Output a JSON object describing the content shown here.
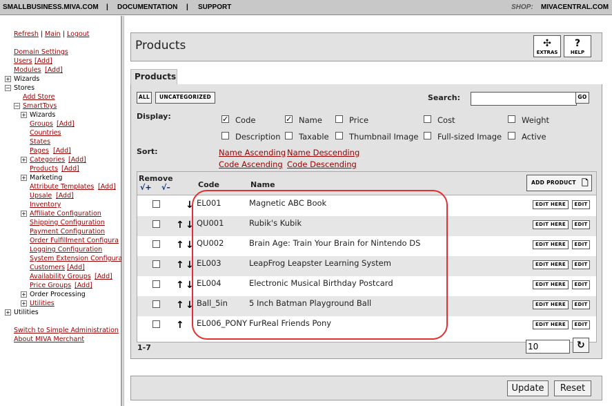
{
  "topbar": {
    "site": "SMALLBUSINESS.MIVA.COM",
    "docs": "DOCUMENTATION",
    "support": "SUPPORT",
    "shop_label": "SHOP:",
    "shop_value": "MIVACENTRAL.COM",
    "sep": "|"
  },
  "sidebar": {
    "refresh": "Refresh",
    "sep": "|",
    "main": "Main",
    "logout": "Logout",
    "domain_settings": "Domain Settings",
    "users": "Users",
    "add": "[Add]",
    "modules": "Modules",
    "wizards": "Wizards",
    "stores": "Stores",
    "add_store": "Add Store",
    "smarttoys": "SmartToys",
    "store_items": [
      {
        "label": "Wizards",
        "link": false,
        "add": false,
        "toggle": "+"
      },
      {
        "label": "Groups",
        "link": true,
        "add": true
      },
      {
        "label": "Countries",
        "link": true,
        "add": false
      },
      {
        "label": "States",
        "link": true,
        "add": false
      },
      {
        "label": "Pages",
        "link": true,
        "add": true
      },
      {
        "label": "Categories",
        "link": true,
        "add": true,
        "toggle": "+"
      },
      {
        "label": "Products",
        "link": true,
        "add": true
      },
      {
        "label": "Marketing",
        "link": false,
        "add": false,
        "toggle": "+"
      },
      {
        "label": "Attribute Templates",
        "link": true,
        "add": true
      },
      {
        "label": "Upsale",
        "link": true,
        "add": true
      },
      {
        "label": "Inventory",
        "link": true,
        "add": false
      },
      {
        "label": "Affiliate Configuration",
        "link": true,
        "add": false,
        "toggle": "+"
      },
      {
        "label": "Shipping Configuration",
        "link": true,
        "add": false
      },
      {
        "label": "Payment Configuration",
        "link": true,
        "add": false
      },
      {
        "label": "Order Fulfillment Configura",
        "link": true,
        "add": false
      },
      {
        "label": "Logging Configuration",
        "link": true,
        "add": false
      },
      {
        "label": "System Extension Configura",
        "link": true,
        "add": false
      },
      {
        "label": "Customers",
        "link": true,
        "add": true
      },
      {
        "label": "Availability Groups",
        "link": true,
        "add": true
      },
      {
        "label": "Price Groups",
        "link": true,
        "add": true
      },
      {
        "label": "Order Processing",
        "link": false,
        "add": false,
        "toggle": "+"
      },
      {
        "label": "Utilities",
        "link": true,
        "add": false,
        "toggle": "+"
      }
    ],
    "utilities": "Utilities",
    "switch": "Switch to Simple Administration",
    "about": "About MIVA Merchant"
  },
  "page": {
    "title": "Products",
    "tab": "Products",
    "extras": "EXTRAS",
    "help": "HELP"
  },
  "filters": {
    "all": "ALL",
    "uncategorized": "UNCATEGORIZED",
    "search_label": "Search:",
    "search_value": "",
    "go": "GO"
  },
  "display": {
    "label": "Display:",
    "options": [
      {
        "label": "Code",
        "checked": true
      },
      {
        "label": "Name",
        "checked": true
      },
      {
        "label": "Price",
        "checked": false
      },
      {
        "label": "Cost",
        "checked": false
      },
      {
        "label": "Weight",
        "checked": false
      },
      {
        "label": "Description",
        "checked": false
      },
      {
        "label": "Taxable",
        "checked": false
      },
      {
        "label": "Thumbnail Image",
        "checked": false
      },
      {
        "label": "Full-sized Image",
        "checked": false
      },
      {
        "label": "Active",
        "checked": false
      }
    ]
  },
  "sort": {
    "label": "Sort:",
    "name_asc": "Name Ascending",
    "name_desc": "Name Descending",
    "code_asc": "Code Ascending",
    "code_desc": "Code Descending"
  },
  "grid": {
    "remove": "Remove",
    "check_plus": "√+",
    "check_minus": "√–",
    "col_code": "Code",
    "col_name": "Name",
    "add_product": "ADD PRODUCT",
    "rows": [
      {
        "code": "EL001",
        "name": "Magnetic ABC Book",
        "up": false,
        "down": true
      },
      {
        "code": "QU001",
        "name": "Rubik's Kubik",
        "up": true,
        "down": true
      },
      {
        "code": "QU002",
        "name": "Brain Age: Train Your Brain for Nintendo DS",
        "up": true,
        "down": true
      },
      {
        "code": "EL003",
        "name": "LeapFrog Leapster Learning System",
        "up": true,
        "down": true
      },
      {
        "code": "EL004",
        "name": "Electronic Musical Birthday Postcard",
        "up": true,
        "down": true
      },
      {
        "code": "Ball_5in",
        "name": "5 Inch Batman Playground Ball",
        "up": true,
        "down": true
      },
      {
        "code": "EL006_PONY",
        "name": "FurReal Friends Pony",
        "up": true,
        "down": false
      }
    ],
    "edit_here": "EDIT HERE",
    "edit": "EDIT",
    "range": "1-7",
    "page_size": "10"
  },
  "footer": {
    "update": "Update",
    "reset": "Reset"
  },
  "colors": {
    "link": "#990000",
    "highlight": "#e03030",
    "panel": "#e2e2e2"
  }
}
